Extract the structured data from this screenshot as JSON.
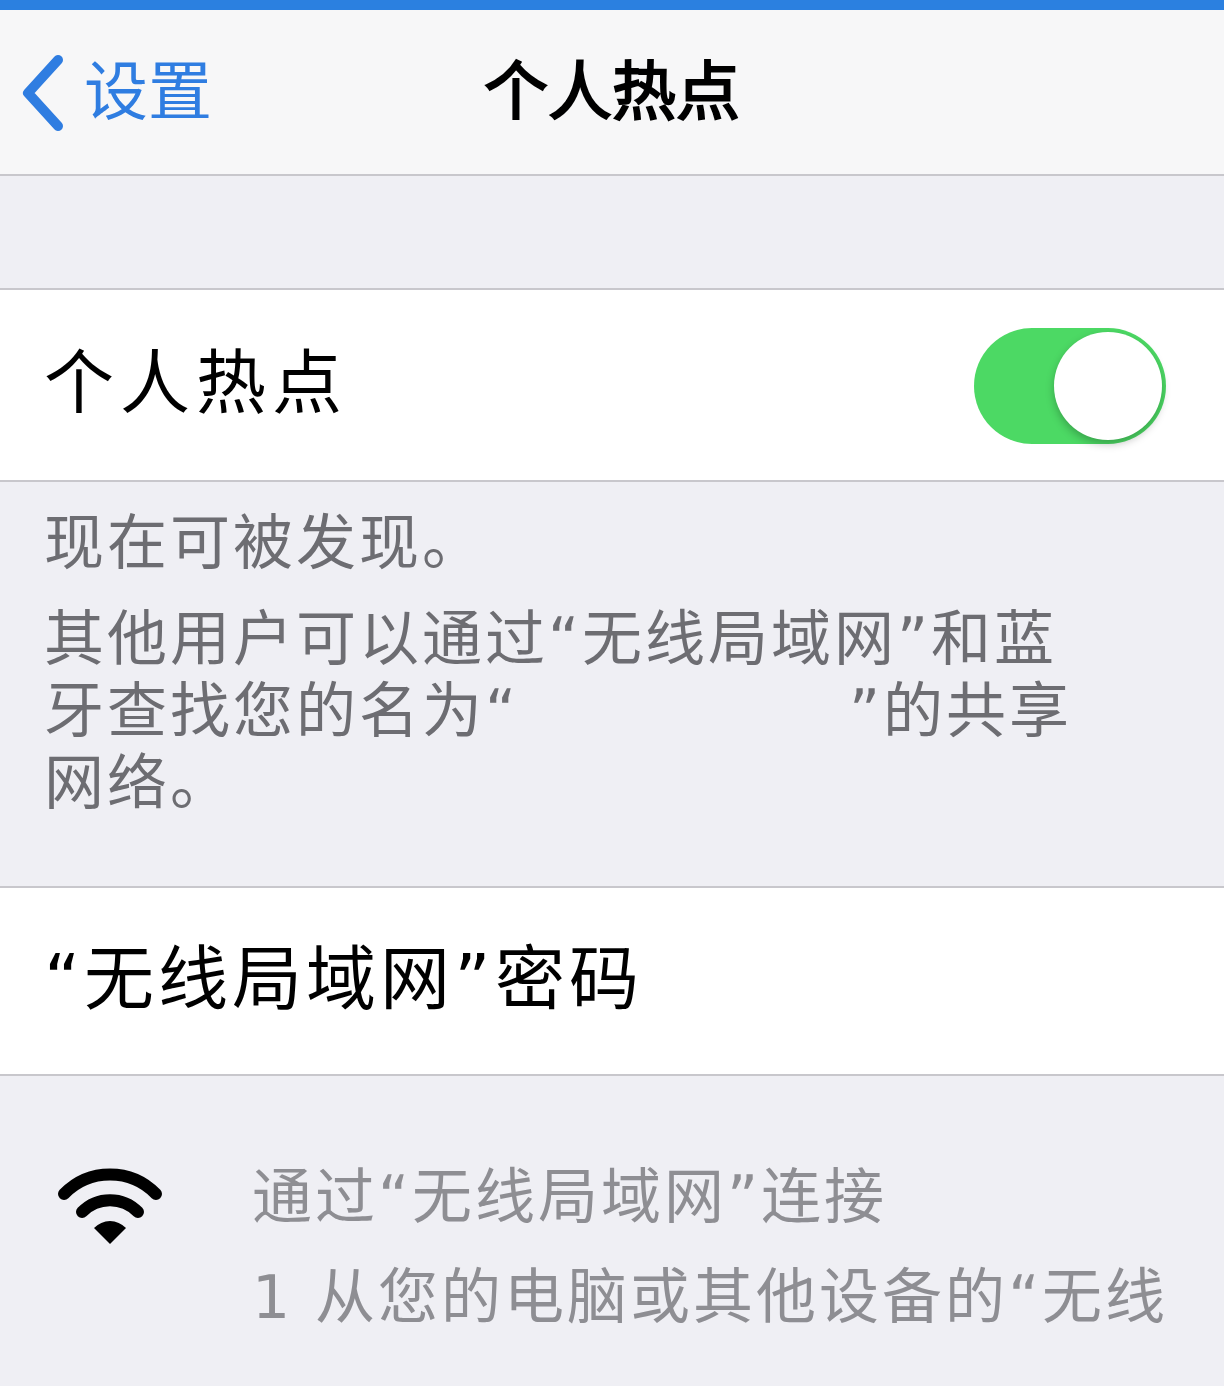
{
  "nav_bar": {
    "back_label": "设置",
    "title": "个人热点"
  },
  "hotspot_row": {
    "label": "个人热点",
    "on": true
  },
  "hotspot_footer": {
    "status": "现在可被发现。",
    "description_before_name": "其他用户可以通过“无线局域网”和蓝牙查找您的名为“",
    "description_after_name": "”的共享网络。"
  },
  "password_row": {
    "label": "“无线局域网”密码"
  },
  "instructions": [
    {
      "kind": "wifi",
      "heading": "通过“无线局域网”连接",
      "steps": [
        "1 从您的电脑或其他设备的“无线"
      ]
    }
  ]
}
